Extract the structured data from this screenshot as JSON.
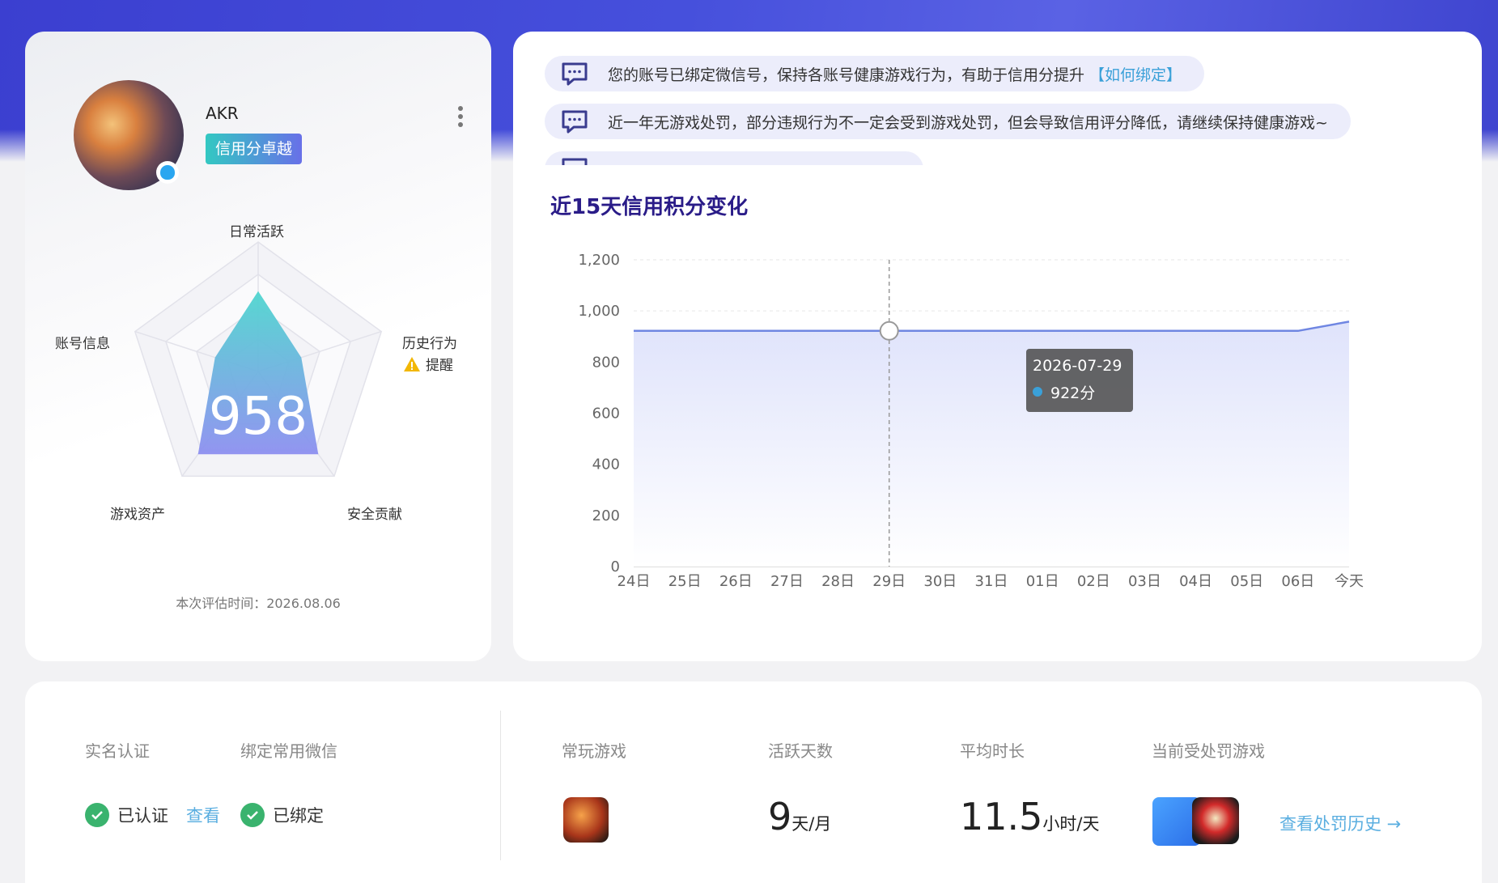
{
  "profile": {
    "username": "AKR",
    "credit_level": "信用分卓越",
    "score": "958",
    "eval_time": "本次评估时间：2026.08.06",
    "radar": {
      "axes": [
        "日常活跃",
        "历史行为",
        "安全贡献",
        "游戏资产",
        "账号信息"
      ],
      "warning": "提醒",
      "values": [
        0.62,
        0.35,
        0.79,
        0.79,
        0.35
      ]
    }
  },
  "notices": [
    {
      "text": "您的账号已绑定微信号，保持各账号健康游戏行为，有助于信用分提升",
      "link": "【如何绑定】"
    },
    {
      "text": "近一年无游戏处罚，部分违规行为不一定会受到游戏处罚，但会导致信用评分降低，请继续保持健康游戏~",
      "link": ""
    }
  ],
  "chart": {
    "title": "近15天信用积分变化",
    "tooltip": {
      "date": "2026-07-29",
      "value": "922分"
    }
  },
  "chart_data": {
    "type": "area",
    "title": "近15天信用积分变化",
    "categories": [
      "24日",
      "25日",
      "26日",
      "27日",
      "28日",
      "29日",
      "30日",
      "31日",
      "01日",
      "02日",
      "03日",
      "04日",
      "05日",
      "06日",
      "今天"
    ],
    "values": [
      922,
      922,
      922,
      922,
      922,
      922,
      922,
      922,
      922,
      922,
      922,
      922,
      922,
      922,
      958
    ],
    "ylim": [
      0,
      1200
    ],
    "yticks": [
      "0",
      "200",
      "400",
      "600",
      "800",
      "1,000",
      "1,200"
    ],
    "grid": true,
    "highlight_index": 5,
    "color": "#6f86e2"
  },
  "bottom": {
    "real_name_label": "实名认证",
    "real_name_status": "已认证",
    "view_link": "查看",
    "wechat_label": "绑定常用微信",
    "wechat_status": "已绑定",
    "games_label": "常玩游戏",
    "active_days_label": "活跃天数",
    "active_days_value": "9",
    "active_days_unit": "天/月",
    "avg_time_label": "平均时长",
    "avg_time_value": "11.5",
    "avg_time_unit": "小时/天",
    "penalty_label": "当前受处罚游戏",
    "penalty_history_link": "查看处罚历史 →"
  },
  "colors": {
    "accent": "#3b3fd0",
    "credit_gradient_start": "#33c8c2",
    "credit_gradient_end": "#6870e8",
    "success": "#3ab36e",
    "link": "#5aaee0"
  }
}
